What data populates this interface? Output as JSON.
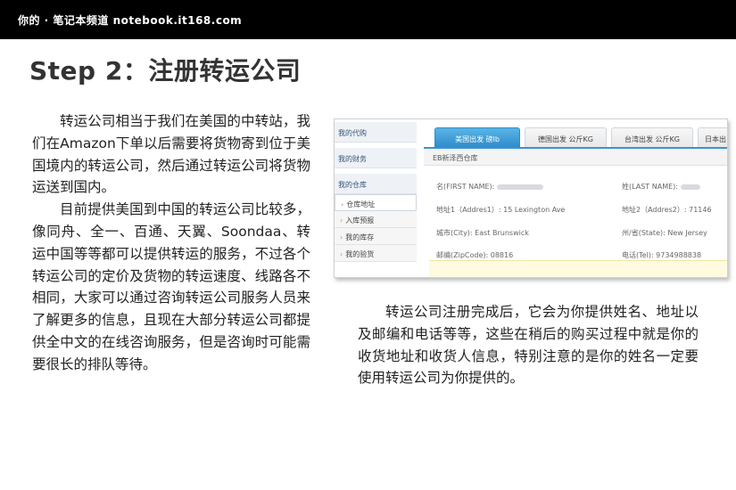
{
  "header": {
    "site": "你的 · 笔记本频道 notebook.it168.com"
  },
  "title": "Step 2：注册转运公司",
  "left_paragraphs": [
    "转运公司相当于我们在美国的中转站，我们在Amazon下单以后需要将货物寄到位于美国境内的转运公司，然后通过转运公司将货物运送到国内。",
    "目前提供美国到中国的转运公司比较多，像同舟、全一、百通、天翼、Soondaa、转运中国等等都可以提供转运的服务，不过各个转运公司的定价及货物的转运速度、线路各不相同，大家可以通过咨询转运公司服务人员来了解更多的信息，且现在大部分转运公司都提供全中文的在线咨询服务，但是咨询时可能需要很长的排队等待。"
  ],
  "right_paragraph": "转运公司注册完成后，它会为你提供姓名、地址以及邮编和电话等等，这些在稍后的购买过程中就是你的收货地址和收货人信息，特别注意的是你的姓名一定要使用转运公司为你提供的。",
  "screenshot": {
    "sidebar": {
      "agent": "我的代购",
      "finance": "我的财务",
      "warehouse": "我的仓库",
      "items": [
        "仓库地址",
        "入库预报",
        "我的库存",
        "我的验货"
      ]
    },
    "tabs": [
      "美国出发 磅lb",
      "德国出发 公斤KG",
      "台湾出发 公斤KG",
      "日本出"
    ],
    "warehouse_title": "EB新泽西仓库",
    "fields": {
      "first_name_label": "名(FIRST NAME):",
      "last_name_label": "姓(LAST NAME):",
      "address1_label": "地址1（Addres1）:",
      "address1_value": "15 Lexington Ave",
      "address2_label": "地址2（Addres2）:",
      "address2_value": "71146",
      "city_label": "城市(City):",
      "city_value": "East Brunswick",
      "state_label": "州/省(State):",
      "state_value": "New Jersey",
      "zip_label": "邮编(ZipCode):",
      "zip_value": "08816",
      "tel_label": "电话(Tel):",
      "tel_value": "9734988838"
    }
  }
}
